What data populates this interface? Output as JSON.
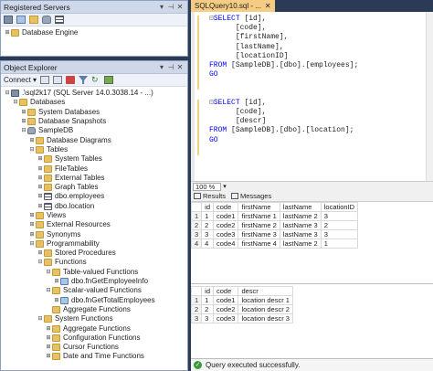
{
  "registered_servers": {
    "title": "Registered Servers",
    "tree": [
      {
        "label": "Database Engine",
        "toggle": "⊞"
      }
    ]
  },
  "object_explorer": {
    "title": "Object Explorer",
    "connect_label": "Connect ▾",
    "tree": [
      {
        "label": ".\\sql2k17 (SQL Server 14.0.3038.14 - ...)",
        "depth": 0,
        "toggle": "⊟",
        "icon": "srv",
        "name": "server-node"
      },
      {
        "label": "Databases",
        "depth": 1,
        "toggle": "⊟",
        "icon": "folder",
        "name": "databases-folder"
      },
      {
        "label": "System Databases",
        "depth": 2,
        "toggle": "⊞",
        "icon": "folder",
        "name": "system-databases-folder"
      },
      {
        "label": "Database Snapshots",
        "depth": 2,
        "toggle": "⊞",
        "icon": "folder",
        "name": "database-snapshots-folder"
      },
      {
        "label": "SampleDB",
        "depth": 2,
        "toggle": "⊟",
        "icon": "db",
        "name": "sampledb-node"
      },
      {
        "label": "Database Diagrams",
        "depth": 3,
        "toggle": "⊞",
        "icon": "folder",
        "name": "database-diagrams-folder"
      },
      {
        "label": "Tables",
        "depth": 3,
        "toggle": "⊟",
        "icon": "folder",
        "name": "tables-folder"
      },
      {
        "label": "System Tables",
        "depth": 4,
        "toggle": "⊞",
        "icon": "folder",
        "name": "system-tables-folder"
      },
      {
        "label": "FileTables",
        "depth": 4,
        "toggle": "⊞",
        "icon": "folder",
        "name": "filetables-folder"
      },
      {
        "label": "External Tables",
        "depth": 4,
        "toggle": "⊞",
        "icon": "folder",
        "name": "external-tables-folder"
      },
      {
        "label": "Graph Tables",
        "depth": 4,
        "toggle": "⊞",
        "icon": "folder",
        "name": "graph-tables-folder"
      },
      {
        "label": "dbo.employees",
        "depth": 4,
        "toggle": "⊞",
        "icon": "tbl",
        "name": "table-employees"
      },
      {
        "label": "dbo.location",
        "depth": 4,
        "toggle": "⊞",
        "icon": "tbl",
        "name": "table-location"
      },
      {
        "label": "Views",
        "depth": 3,
        "toggle": "⊞",
        "icon": "folder",
        "name": "views-folder"
      },
      {
        "label": "External Resources",
        "depth": 3,
        "toggle": "⊞",
        "icon": "folder",
        "name": "external-resources-folder"
      },
      {
        "label": "Synonyms",
        "depth": 3,
        "toggle": "⊞",
        "icon": "folder",
        "name": "synonyms-folder"
      },
      {
        "label": "Programmability",
        "depth": 3,
        "toggle": "⊟",
        "icon": "folder",
        "name": "programmability-folder"
      },
      {
        "label": "Stored Procedures",
        "depth": 4,
        "toggle": "⊞",
        "icon": "folder",
        "name": "stored-procedures-folder"
      },
      {
        "label": "Functions",
        "depth": 4,
        "toggle": "⊟",
        "icon": "folder",
        "name": "functions-folder"
      },
      {
        "label": "Table-valued Functions",
        "depth": 5,
        "toggle": "⊟",
        "icon": "folder",
        "name": "table-valued-functions-folder"
      },
      {
        "label": "dbo.fnGetEmployeeInfo",
        "depth": 6,
        "toggle": "⊞",
        "icon": "fn",
        "name": "fn-get-employee-info"
      },
      {
        "label": "Scalar-valued Functions",
        "depth": 5,
        "toggle": "⊟",
        "icon": "folder",
        "name": "scalar-valued-functions-folder"
      },
      {
        "label": "dbo.fnGetTotalEmployees",
        "depth": 6,
        "toggle": "⊞",
        "icon": "fn",
        "name": "fn-get-total-employees"
      },
      {
        "label": "Aggregate Functions",
        "depth": 5,
        "toggle": "",
        "icon": "folder",
        "name": "aggregate-functions-folder"
      },
      {
        "label": "System Functions",
        "depth": 4,
        "toggle": "⊟",
        "icon": "folder",
        "name": "system-functions-folder"
      },
      {
        "label": "Aggregate Functions",
        "depth": 5,
        "toggle": "⊞",
        "icon": "folder",
        "name": "sys-aggregate-functions-folder"
      },
      {
        "label": "Configuration Functions",
        "depth": 5,
        "toggle": "⊞",
        "icon": "folder",
        "name": "configuration-functions-folder"
      },
      {
        "label": "Cursor Functions",
        "depth": 5,
        "toggle": "⊞",
        "icon": "folder",
        "name": "cursor-functions-folder"
      },
      {
        "label": "Date and Time Functions",
        "depth": 5,
        "toggle": "⊞",
        "icon": "folder",
        "name": "date-time-functions-folder"
      }
    ]
  },
  "editor": {
    "tab_label": "SQLQuery10.sql - ...",
    "zoom": "100 %",
    "query1": {
      "select_kw": "SELECT",
      "cols": [
        "[id],",
        "[code],",
        "[firstName],",
        "[lastName],",
        "[locationID]"
      ],
      "from_kw": "FROM",
      "table": "[SampleDB].[dbo].[employees];",
      "go": "GO"
    },
    "query2": {
      "select_kw": "SELECT",
      "cols": [
        "[id],",
        "[code],",
        "[descr]"
      ],
      "from_kw": "FROM",
      "table": "[SampleDB].[dbo].[location];",
      "go": "GO"
    }
  },
  "results": {
    "tab_results": "Results",
    "tab_messages": "Messages",
    "grid1": {
      "headers": [
        "id",
        "code",
        "firstName",
        "lastName",
        "locationID"
      ],
      "rows": [
        [
          "1",
          "code1",
          "firstName 1",
          "lastName 2",
          "3"
        ],
        [
          "2",
          "code2",
          "firstName 2",
          "lastName 3",
          "2"
        ],
        [
          "3",
          "code3",
          "firstName 3",
          "lastName 3",
          "3"
        ],
        [
          "4",
          "code4",
          "firstName 4",
          "lastName 2",
          "1"
        ]
      ]
    },
    "grid2": {
      "headers": [
        "id",
        "code",
        "descr"
      ],
      "rows": [
        [
          "1",
          "code1",
          "location descr 1"
        ],
        [
          "2",
          "code2",
          "location descr 2"
        ],
        [
          "3",
          "code3",
          "location descr 3"
        ]
      ]
    },
    "status": "Query executed successfully."
  }
}
